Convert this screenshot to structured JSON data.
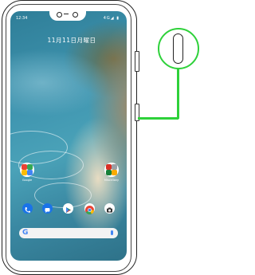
{
  "status_bar": {
    "time": "12:34",
    "indicators": "4G◢ ▮"
  },
  "lock_date": "11月11日月曜日",
  "home_widgets": [
    {
      "label": "Google"
    },
    {
      "label": "Miscellany"
    }
  ],
  "dock_apps": [
    {
      "name": "phone-icon",
      "color": "#1a73e8"
    },
    {
      "name": "messages-icon",
      "color": "#1a73e8"
    },
    {
      "name": "play-store-icon",
      "color": "#ffffff"
    },
    {
      "name": "chrome-icon",
      "color": "#ffffff"
    },
    {
      "name": "camera-icon",
      "color": "#ffffff"
    }
  ],
  "search_bar": {
    "logo": "G"
  },
  "highlight": {
    "target": "side-key",
    "color": "#2ed13a"
  }
}
